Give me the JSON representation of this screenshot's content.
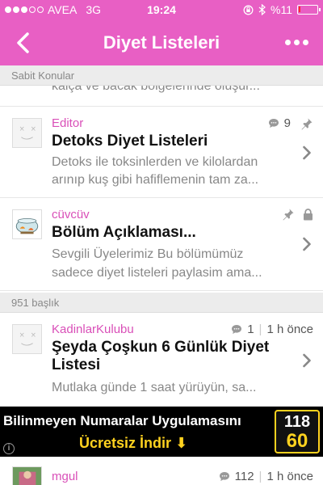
{
  "status_bar": {
    "carrier": "AVEA",
    "network": "3G",
    "time": "19:24",
    "battery_label": "%11",
    "signal_bars_filled": 3,
    "signal_bars_total": 5,
    "battery_level": 0.11
  },
  "nav": {
    "title": "Diyet Listeleri"
  },
  "sections": {
    "pinned": "Sabit Konular",
    "count": "951 başlık"
  },
  "partial_excerpt": "kalça ve bacak bölgelerinde oluşur...",
  "pinned_topics": [
    {
      "author": "Editor",
      "count": "9",
      "title": "Detoks Diyet Listeleri",
      "excerpt_line1": "Detoks ile toksinlerden ve kilolardan",
      "excerpt_line2": "arınıp kuş gibi hafiflemenin tam za..."
    },
    {
      "author": "cüvcüv",
      "title": "Bölüm Açıklaması...",
      "excerpt_line1": "Sevgili Üyelerimiz Bu bölümümüz",
      "excerpt_line2": "sadece diyet listeleri paylasim ama..."
    }
  ],
  "topics": [
    {
      "author": "KadinlarKulubu",
      "count": "1",
      "time": "1 h önce",
      "title_line1": "Şeyda Çoşkun 6 Günlük Diyet",
      "title_line2": "Listesi",
      "excerpt": "Mutlaka günde 1 saat yürüyün, sa..."
    },
    {
      "author": "mgul",
      "count": "112",
      "time": "1 h önce"
    }
  ],
  "ad": {
    "line1": "Bilinmeyen Numaralar Uygulamasını",
    "line2": "Ücretsiz İndir ⬇",
    "badge_top": "118",
    "badge_bottom": "60",
    "info_icon": "i"
  },
  "colors": {
    "accent": "#e85fc4",
    "author": "#d94fb8",
    "ad_yellow": "#ffd21f",
    "battery_red": "#ff2a2a"
  }
}
